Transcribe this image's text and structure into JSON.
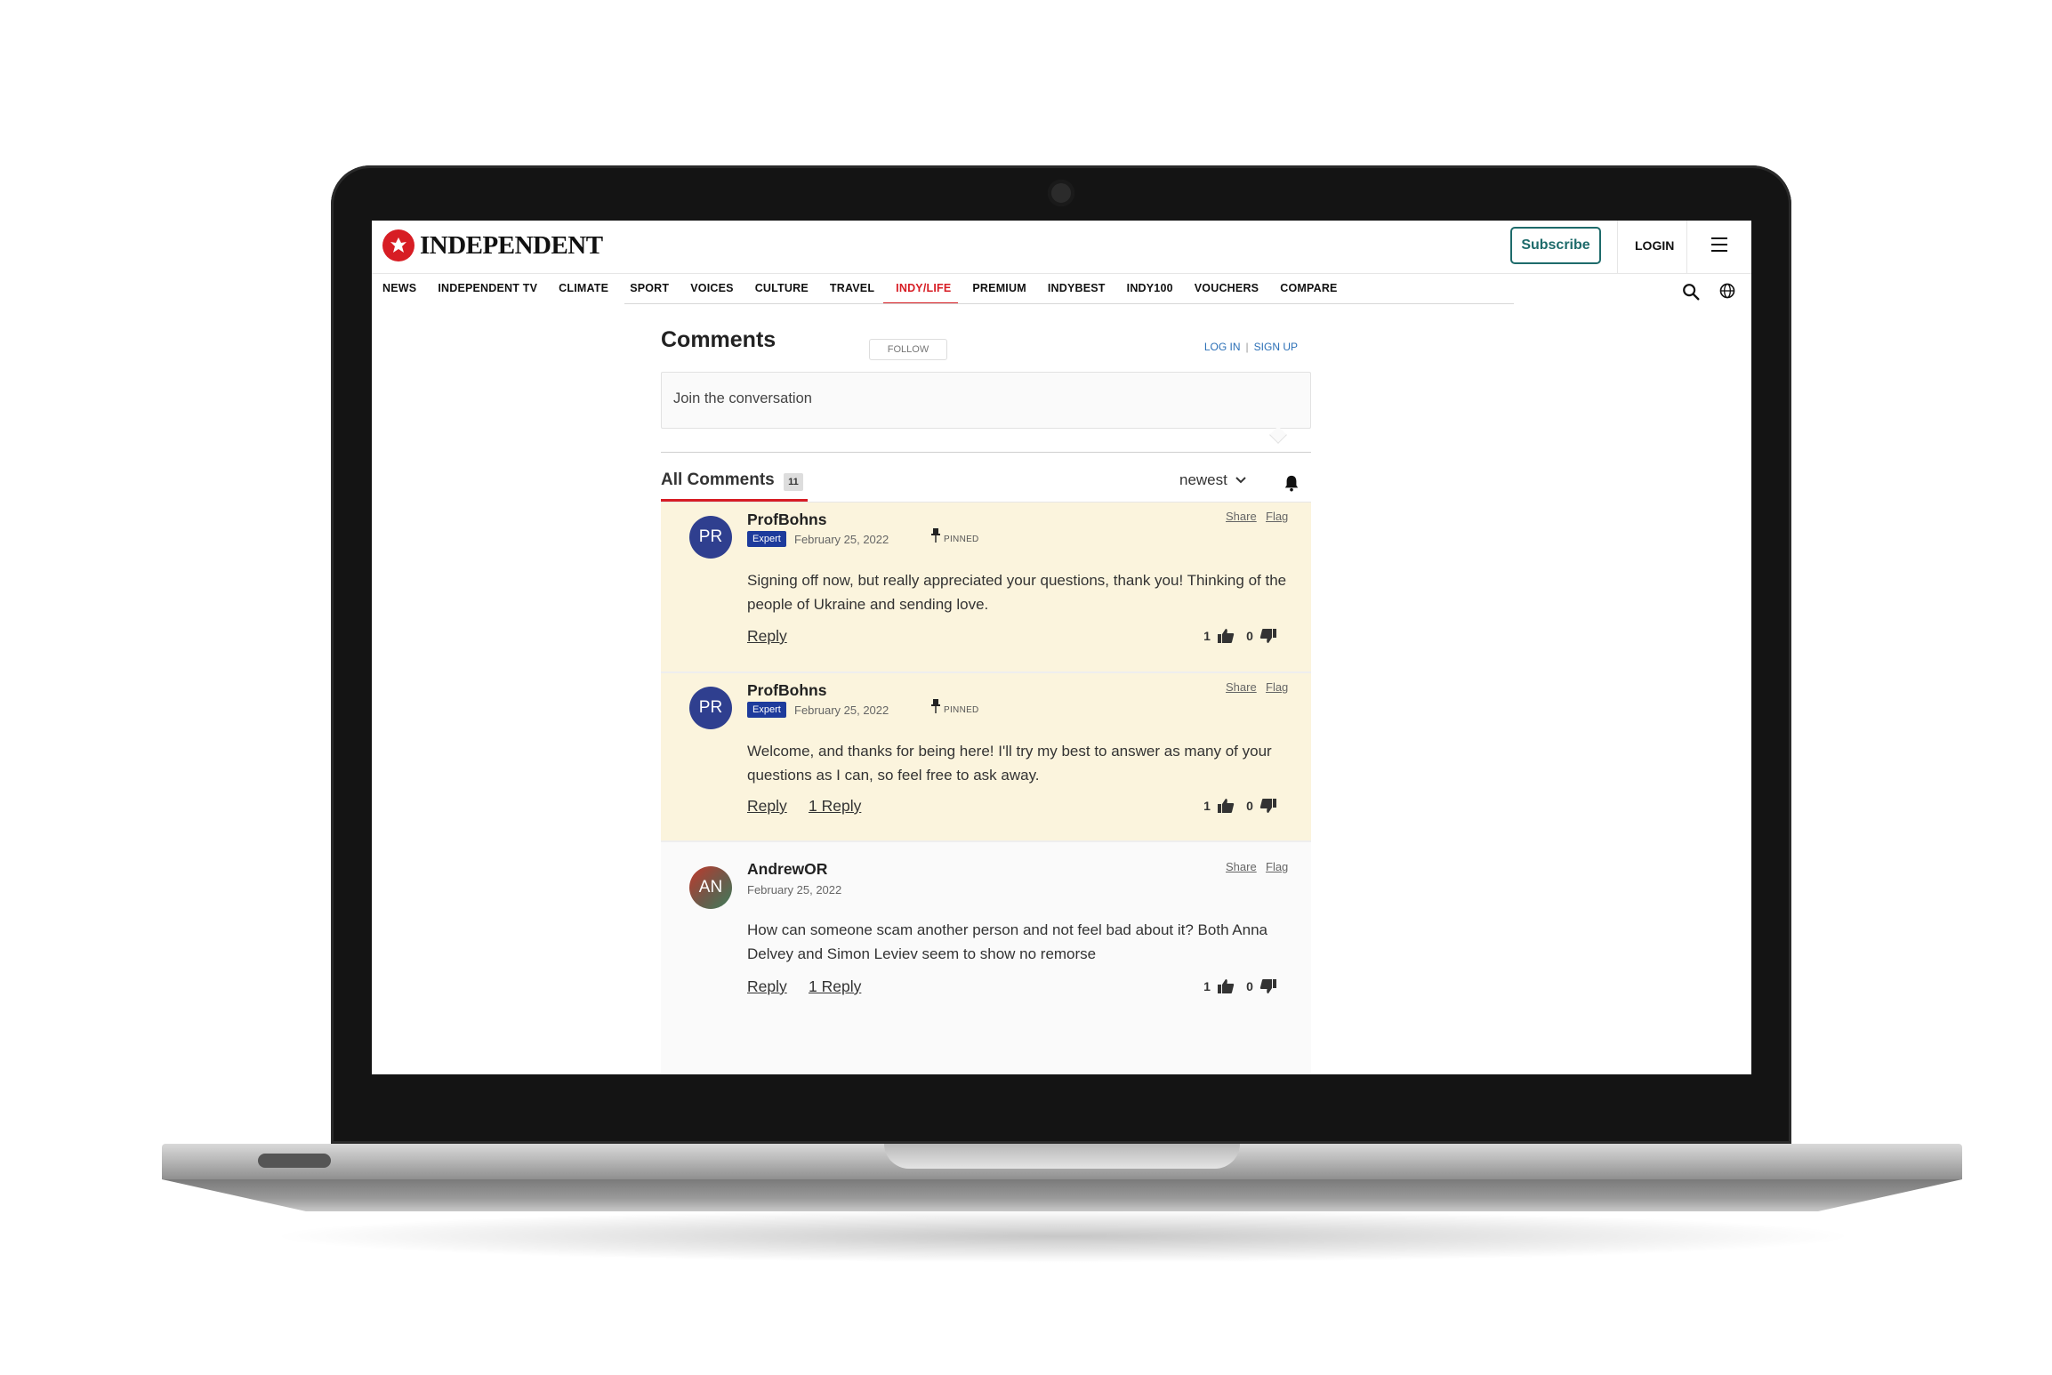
{
  "header": {
    "logo_text": "INDEPENDENT",
    "subscribe_label": "Subscribe",
    "login_label": "LOGIN"
  },
  "nav": {
    "items": [
      "NEWS",
      "INDEPENDENT TV",
      "CLIMATE",
      "SPORT",
      "VOICES",
      "CULTURE",
      "TRAVEL",
      "INDY/LIFE",
      "PREMIUM",
      "INDYBEST",
      "INDY100",
      "VOUCHERS",
      "COMPARE"
    ],
    "active": "INDY/LIFE"
  },
  "comments": {
    "title": "Comments",
    "follow_label": "FOLLOW",
    "login_label": "LOG IN",
    "signup_label": "SIGN UP",
    "join_placeholder": "Join the conversation",
    "all_comments_label": "All Comments",
    "count": "11",
    "sort_value": "newest",
    "list": [
      {
        "initials": "PR",
        "author": "ProfBohns",
        "badge": "Expert",
        "date": "February 25, 2022",
        "pinned_label": "PINNED",
        "share_label": "Share",
        "flag_label": "Flag",
        "body": "Signing off now, but really appreciated your questions, thank you! Thinking of the people of Ukraine and sending love.",
        "reply_label": "Reply",
        "replies_label": "",
        "likes": "1",
        "dislikes": "0"
      },
      {
        "initials": "PR",
        "author": "ProfBohns",
        "badge": "Expert",
        "date": "February 25, 2022",
        "pinned_label": "PINNED",
        "share_label": "Share",
        "flag_label": "Flag",
        "body": "Welcome, and thanks for being here! I'll try my best to answer as many of your questions as I can, so feel free to ask away.",
        "reply_label": "Reply",
        "replies_label": "1 Reply",
        "likes": "1",
        "dislikes": "0"
      },
      {
        "initials": "AN",
        "author": "AndrewOR",
        "badge": "",
        "date": "February 25, 2022",
        "pinned_label": "",
        "share_label": "Share",
        "flag_label": "Flag",
        "body": "How can someone scam another person and not feel bad about it? Both Anna Delvey and Simon Leviev seem to show no remorse",
        "reply_label": "Reply",
        "replies_label": "1 Reply",
        "likes": "1",
        "dislikes": "0"
      }
    ]
  },
  "colors": {
    "brand_red": "#d71d24",
    "subscribe_teal": "#1e6b6b",
    "pinned_bg": "#fbf4dd",
    "expert_blue": "#1d3b9c",
    "link_blue": "#2b6fb6"
  },
  "icons": [
    "eagle-logo-icon",
    "menu-icon",
    "search-icon",
    "globe-icon",
    "chevron-down-icon",
    "bell-icon",
    "pin-icon",
    "thumbs-up-icon",
    "thumbs-down-icon"
  ]
}
